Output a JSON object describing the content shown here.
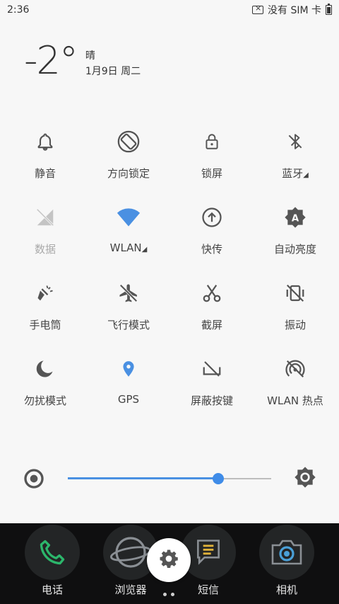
{
  "status": {
    "time": "2:36",
    "sim_text": "没有 SIM 卡"
  },
  "weather": {
    "temperature": "-2°",
    "condition": "晴",
    "date": "1月9日 周二"
  },
  "tiles": [
    {
      "label": "静音",
      "icon": "bell-icon",
      "state": "off"
    },
    {
      "label": "方向锁定",
      "icon": "rotation-lock-icon",
      "state": "off"
    },
    {
      "label": "锁屏",
      "icon": "lock-icon",
      "state": "off"
    },
    {
      "label": "蓝牙",
      "icon": "bluetooth-off-icon",
      "state": "off",
      "expandable": true
    },
    {
      "label": "数据",
      "icon": "mobile-data-icon",
      "state": "disabled"
    },
    {
      "label": "WLAN",
      "icon": "wifi-icon",
      "state": "on",
      "expandable": true
    },
    {
      "label": "快传",
      "icon": "quick-share-icon",
      "state": "off"
    },
    {
      "label": "自动亮度",
      "icon": "auto-brightness-icon",
      "state": "off"
    },
    {
      "label": "手电筒",
      "icon": "flashlight-icon",
      "state": "off"
    },
    {
      "label": "飞行模式",
      "icon": "airplane-off-icon",
      "state": "off"
    },
    {
      "label": "截屏",
      "icon": "scissors-icon",
      "state": "off"
    },
    {
      "label": "振动",
      "icon": "vibrate-off-icon",
      "state": "off"
    },
    {
      "label": "勿扰模式",
      "icon": "moon-icon",
      "state": "off"
    },
    {
      "label": "GPS",
      "icon": "location-pin-icon",
      "state": "on"
    },
    {
      "label": "屏蔽按键",
      "icon": "block-keys-icon",
      "state": "off"
    },
    {
      "label": "WLAN 热点",
      "icon": "hotspot-off-icon",
      "state": "off"
    }
  ],
  "brightness": {
    "level": 0.74
  },
  "dock": {
    "items": [
      {
        "label": "电话",
        "icon": "phone-icon"
      },
      {
        "label": "浏览器",
        "icon": "browser-icon"
      },
      {
        "label": "短信",
        "icon": "sms-icon"
      },
      {
        "label": "相机",
        "icon": "camera-icon"
      }
    ],
    "settings_icon": "gear-icon",
    "page_count": 2
  },
  "colors": {
    "accent": "#4a90e2",
    "dock_bg": "#0f0f10",
    "panel_bg": "#f7f7f7",
    "icon": "#555555",
    "disabled": "#bdbdbd"
  }
}
